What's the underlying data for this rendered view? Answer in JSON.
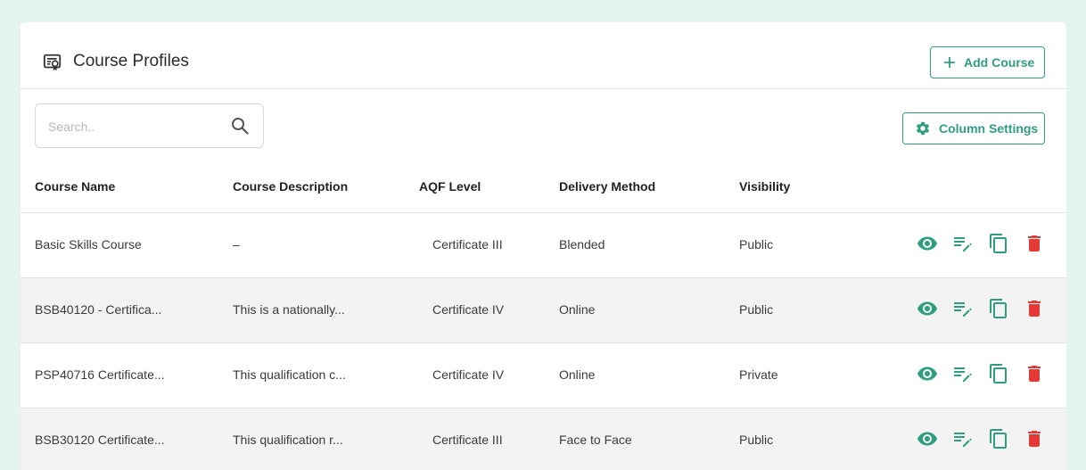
{
  "header": {
    "title": "Course Profiles",
    "add_label": "Add Course"
  },
  "toolbar": {
    "search_placeholder": "Search..",
    "column_settings_label": "Column Settings"
  },
  "table": {
    "columns": [
      "Course Name",
      "Course Description",
      "AQF Level",
      "Delivery Method",
      "Visibility"
    ],
    "rows": [
      {
        "name": "Basic Skills Course",
        "description": "–",
        "aqf": "Certificate III",
        "delivery": "Blended",
        "visibility": "Public"
      },
      {
        "name": "BSB40120 - Certifica...",
        "description": "This is a nationally...",
        "aqf": "Certificate IV",
        "delivery": "Online",
        "visibility": "Public"
      },
      {
        "name": "PSP40716 Certificate...",
        "description": "This qualification c...",
        "aqf": "Certificate IV",
        "delivery": "Online",
        "visibility": "Private"
      },
      {
        "name": "BSB30120 Certificate...",
        "description": "This qualification r...",
        "aqf": "Certificate III",
        "delivery": "Face to Face",
        "visibility": "Public"
      }
    ],
    "row_actions": [
      "eye-icon",
      "edit-icon",
      "copy-icon",
      "delete-icon"
    ]
  },
  "colors": {
    "accent": "#2f9e80",
    "danger": "#e53935",
    "background": "#e6f4ef"
  }
}
